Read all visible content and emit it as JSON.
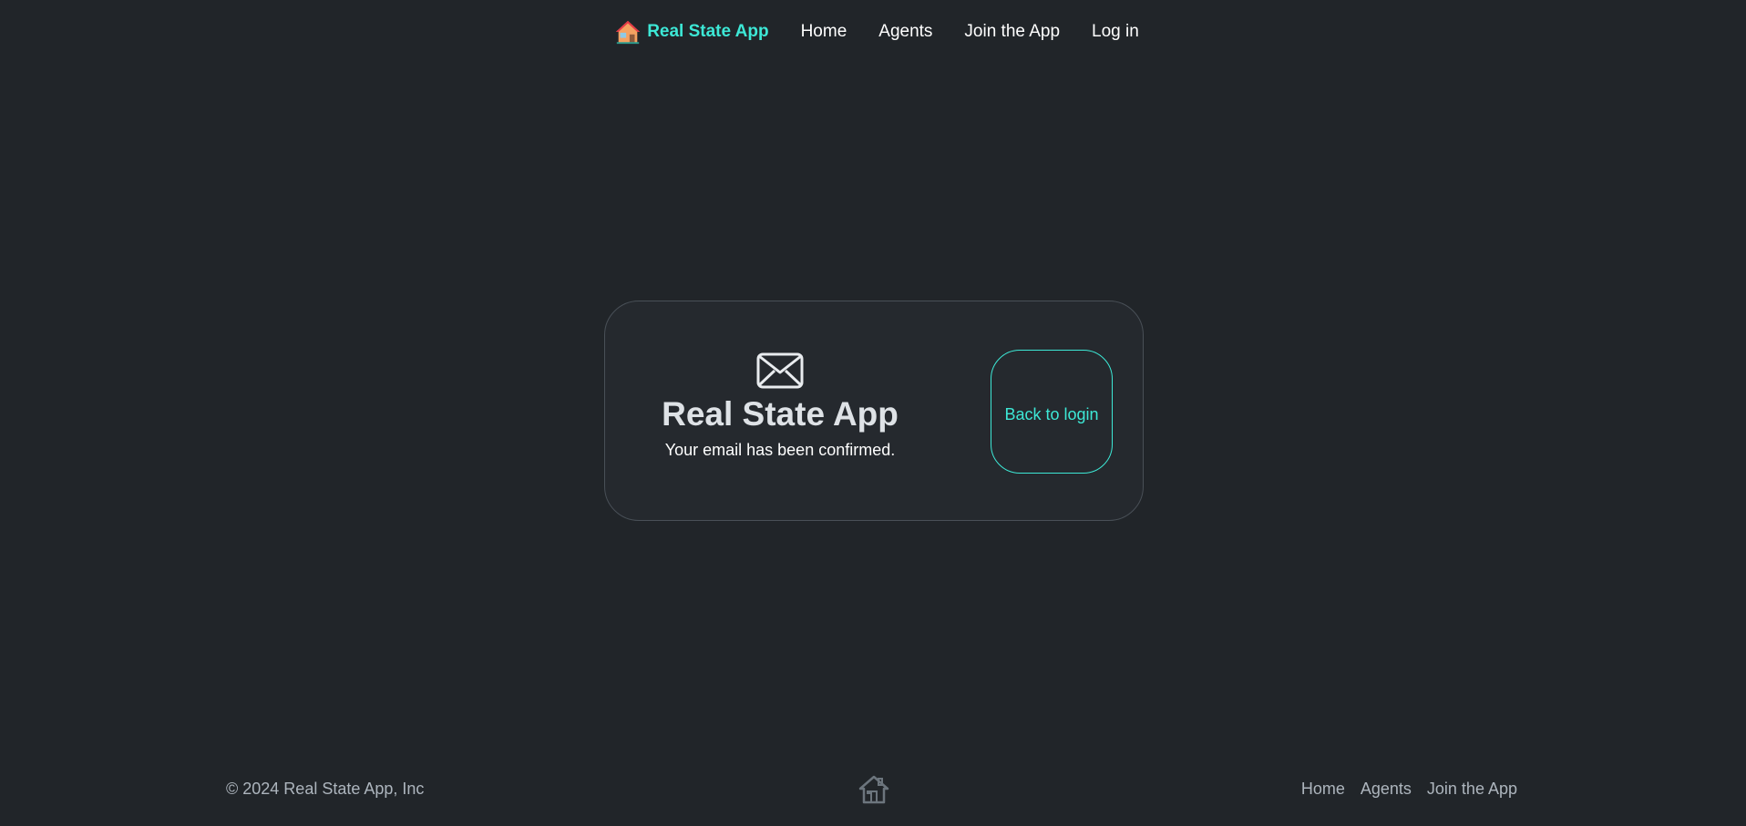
{
  "navbar": {
    "brand_label": "Real State App",
    "brand_icon": "house-icon",
    "links": [
      {
        "label": "Home"
      },
      {
        "label": "Agents"
      },
      {
        "label": "Join the App"
      },
      {
        "label": "Log in"
      }
    ]
  },
  "card": {
    "icon": "envelope-icon",
    "title": "Real State App",
    "message": "Your email has been confirmed.",
    "back_button_label": "Back to login"
  },
  "footer": {
    "copyright": "© 2024 Real State App, Inc",
    "logo_icon": "house-icon",
    "links": [
      {
        "label": "Home"
      },
      {
        "label": "Agents"
      },
      {
        "label": "Join the App"
      }
    ]
  },
  "colors": {
    "background": "#212529",
    "accent": "#3de8d6",
    "card_background": "#25292e",
    "muted_text": "#adb5bd"
  }
}
